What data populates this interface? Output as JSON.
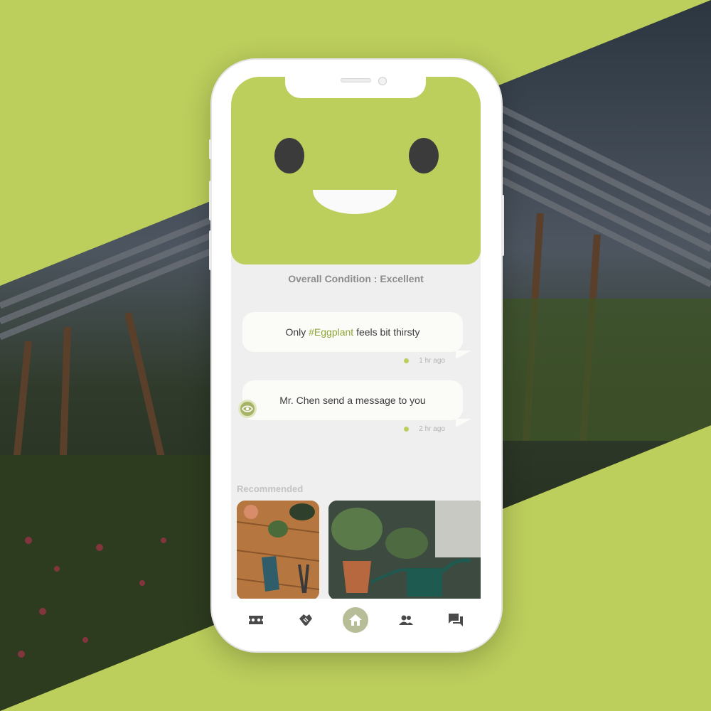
{
  "status": {
    "condition_label": "Overall Condition : Excellent"
  },
  "messages": [
    {
      "prefix": "Only ",
      "tag": "#Eggplant",
      "suffix": " feels bit thirsty",
      "time": "1 hr ago"
    },
    {
      "text": "Mr. Chen send a message to you",
      "time": "2 hr ago"
    }
  ],
  "recommended": {
    "heading": "Recommended",
    "cards": [
      {
        "icon": "gardening-tools-photo"
      },
      {
        "icon": "watering-can-photo"
      }
    ]
  },
  "tabbar": {
    "items": [
      {
        "icon": "tickets-icon"
      },
      {
        "icon": "handshake-icon"
      },
      {
        "icon": "home-icon",
        "active": true
      },
      {
        "icon": "people-icon"
      },
      {
        "icon": "chat-icon"
      }
    ]
  },
  "colors": {
    "accent": "#bcce5c",
    "tag": "#8ea53a",
    "background": "#bcce5c"
  }
}
